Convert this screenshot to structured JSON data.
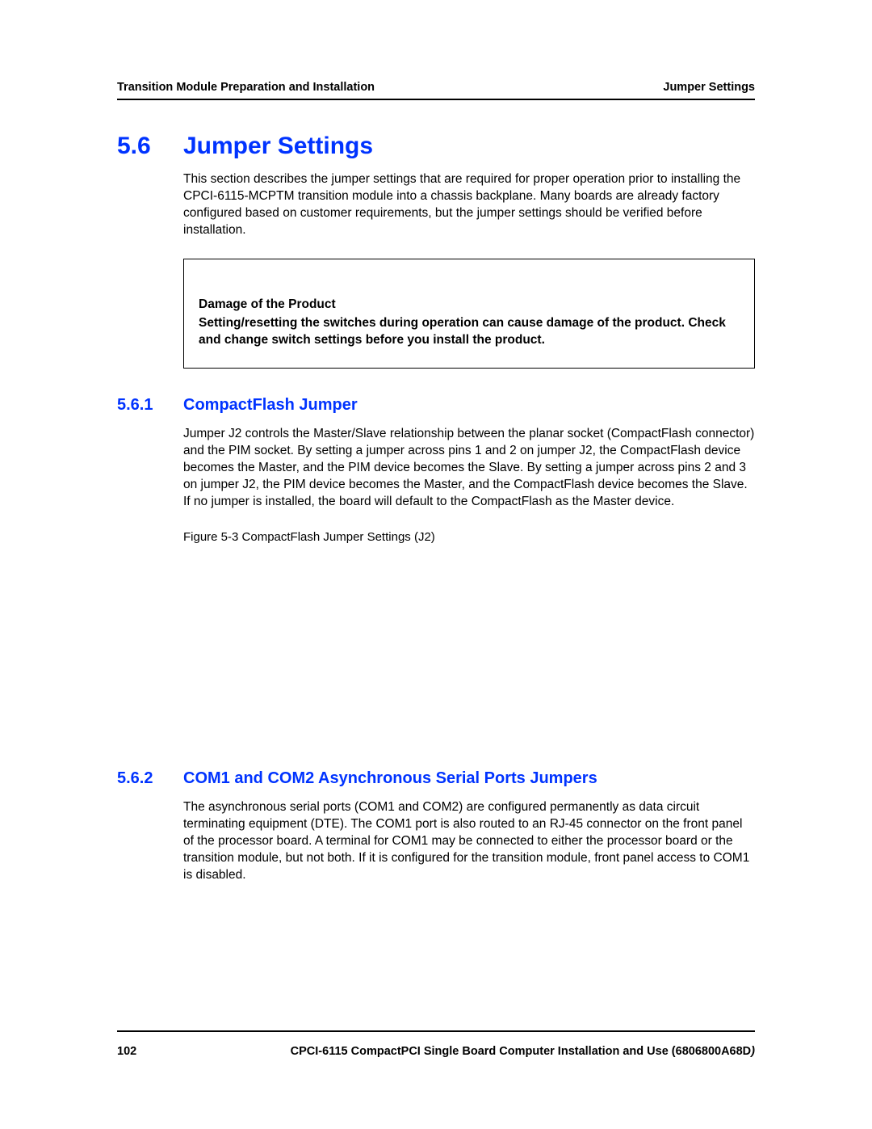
{
  "header": {
    "left": "Transition Module Preparation and Installation",
    "right": "Jumper Settings"
  },
  "section": {
    "number": "5.6",
    "title": "Jumper Settings",
    "intro": "This section describes the jumper settings that are required for proper operation prior to installing the CPCI-6115-MCPTM transition module into a chassis backplane. Many boards are already factory configured based on customer requirements, but the jumper settings should be verified before installation."
  },
  "note": {
    "title": "Damage of the Product",
    "body": "Setting/resetting the switches during operation can cause damage of the product. Check and change switch settings before you install the product."
  },
  "subsections": [
    {
      "number": "5.6.1",
      "title": "CompactFlash Jumper",
      "body": "Jumper J2 controls the Master/Slave relationship between the planar socket (CompactFlash connector) and the PIM socket. By setting a jumper across pins 1 and 2 on jumper J2, the CompactFlash device becomes the Master, and the PIM device becomes the Slave. By setting a jumper across pins 2 and 3 on jumper J2, the PIM device becomes the Master, and the CompactFlash device becomes the Slave. If no jumper is installed, the board will default to the CompactFlash as the Master device.",
      "figure_caption": "Figure 5-3    CompactFlash Jumper Settings (J2)"
    },
    {
      "number": "5.6.2",
      "title": "COM1 and COM2 Asynchronous Serial Ports Jumpers",
      "body": "The asynchronous serial ports (COM1 and COM2) are configured permanently as data circuit terminating equipment (DTE). The COM1 port is also routed to an RJ-45 connector on the front panel of the processor board. A terminal for COM1 may be connected to either the processor board or the transition module, but not both. If it is configured for the transition module, front panel access to COM1 is disabled."
    }
  ],
  "footer": {
    "page_number": "102",
    "doc_title": "CPCI-6115 CompactPCI Single Board Computer Installation and Use (6806800A68D",
    "doc_title_italic_suffix": ")"
  }
}
